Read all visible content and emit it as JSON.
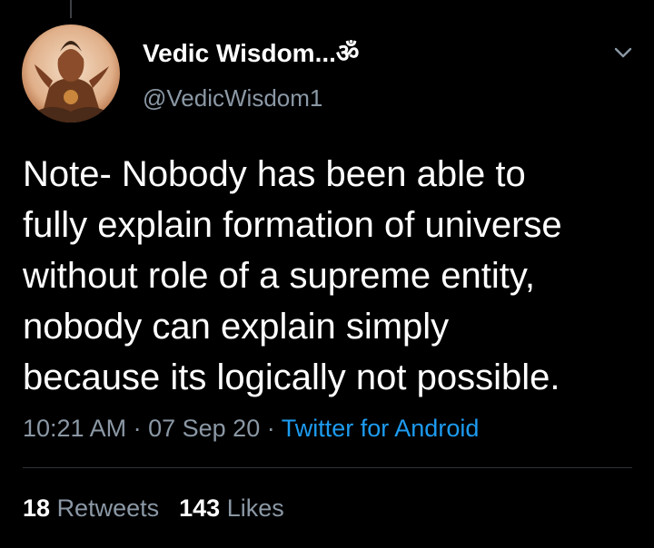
{
  "tweet": {
    "author": {
      "display_name": "Vedic Wisdom...ॐ",
      "handle": "@VedicWisdom1"
    },
    "text_lines": [
      "Note- Nobody has been able to",
      "fully explain formation of universe",
      "without role of a supreme entity,",
      "nobody can explain simply",
      "because its logically not possible."
    ],
    "time": "10:21 AM",
    "separator": "·",
    "date": "07 Sep 20",
    "source": "Twitter for Android",
    "retweets": {
      "count": "18",
      "label": "Retweets"
    },
    "likes": {
      "count": "143",
      "label": "Likes"
    }
  },
  "icons": {
    "caret": "chevron-down-icon",
    "avatar": "profile-avatar"
  },
  "colors": {
    "background": "#000000",
    "primary_text": "#ffffff",
    "secondary_text": "#8b98a5",
    "link": "#1d9bf0",
    "divider": "#2f3336"
  }
}
